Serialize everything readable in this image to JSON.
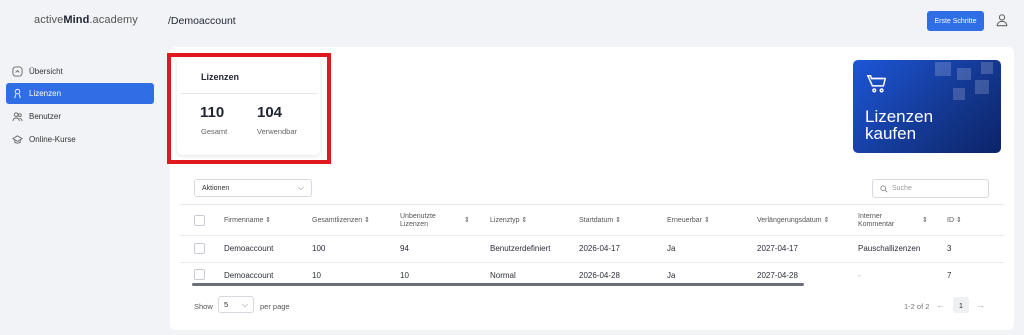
{
  "header": {
    "logo_prefix": "active",
    "logo_bold": "Mind",
    "logo_suffix": ".academy",
    "breadcrumb": "/Demoaccount",
    "start_button": "Erste Schritte"
  },
  "sidebar": {
    "items": [
      {
        "label": "Übersicht",
        "icon": "overview-icon"
      },
      {
        "label": "Lizenzen",
        "icon": "licenses-icon",
        "active": true
      },
      {
        "label": "Benutzer",
        "icon": "users-icon"
      },
      {
        "label": "Online-Kurse",
        "icon": "courses-icon"
      }
    ]
  },
  "licenses_card": {
    "title": "Lizenzen",
    "total_value": "110",
    "total_label": "Gesamt",
    "usable_value": "104",
    "usable_label": "Verwendbar"
  },
  "promo": {
    "line1": "Lizenzen",
    "line2": "kaufen"
  },
  "toolbar": {
    "actions_label": "Aktionen",
    "search_placeholder": "Suche"
  },
  "table": {
    "headers": [
      "Firmenname",
      "Gesamtlizenzen",
      "Unbenutzte\nLizenzen",
      "Lizenztyp",
      "Startdatum",
      "Erneuerbar",
      "Verlängerungsdatum",
      "Interner\nKommentar",
      "ID"
    ],
    "rows": [
      [
        "Demoaccount",
        "100",
        "94",
        "Benutzerdefiniert",
        "2026-04-17",
        "Ja",
        "2027-04-17",
        "Pauschallizenzen",
        "3"
      ],
      [
        "Demoaccount",
        "10",
        "10",
        "Normal",
        "2026-04-28",
        "Ja",
        "2027-04-28",
        "-",
        "7"
      ]
    ]
  },
  "pagination": {
    "show_label": "Show",
    "per_page_value": "5",
    "per_page_label": "per page",
    "range_text": "1-2 of 2",
    "current_page": "1"
  },
  "colors": {
    "accent": "#2f6ee5",
    "highlight_box": "#e0191f"
  }
}
